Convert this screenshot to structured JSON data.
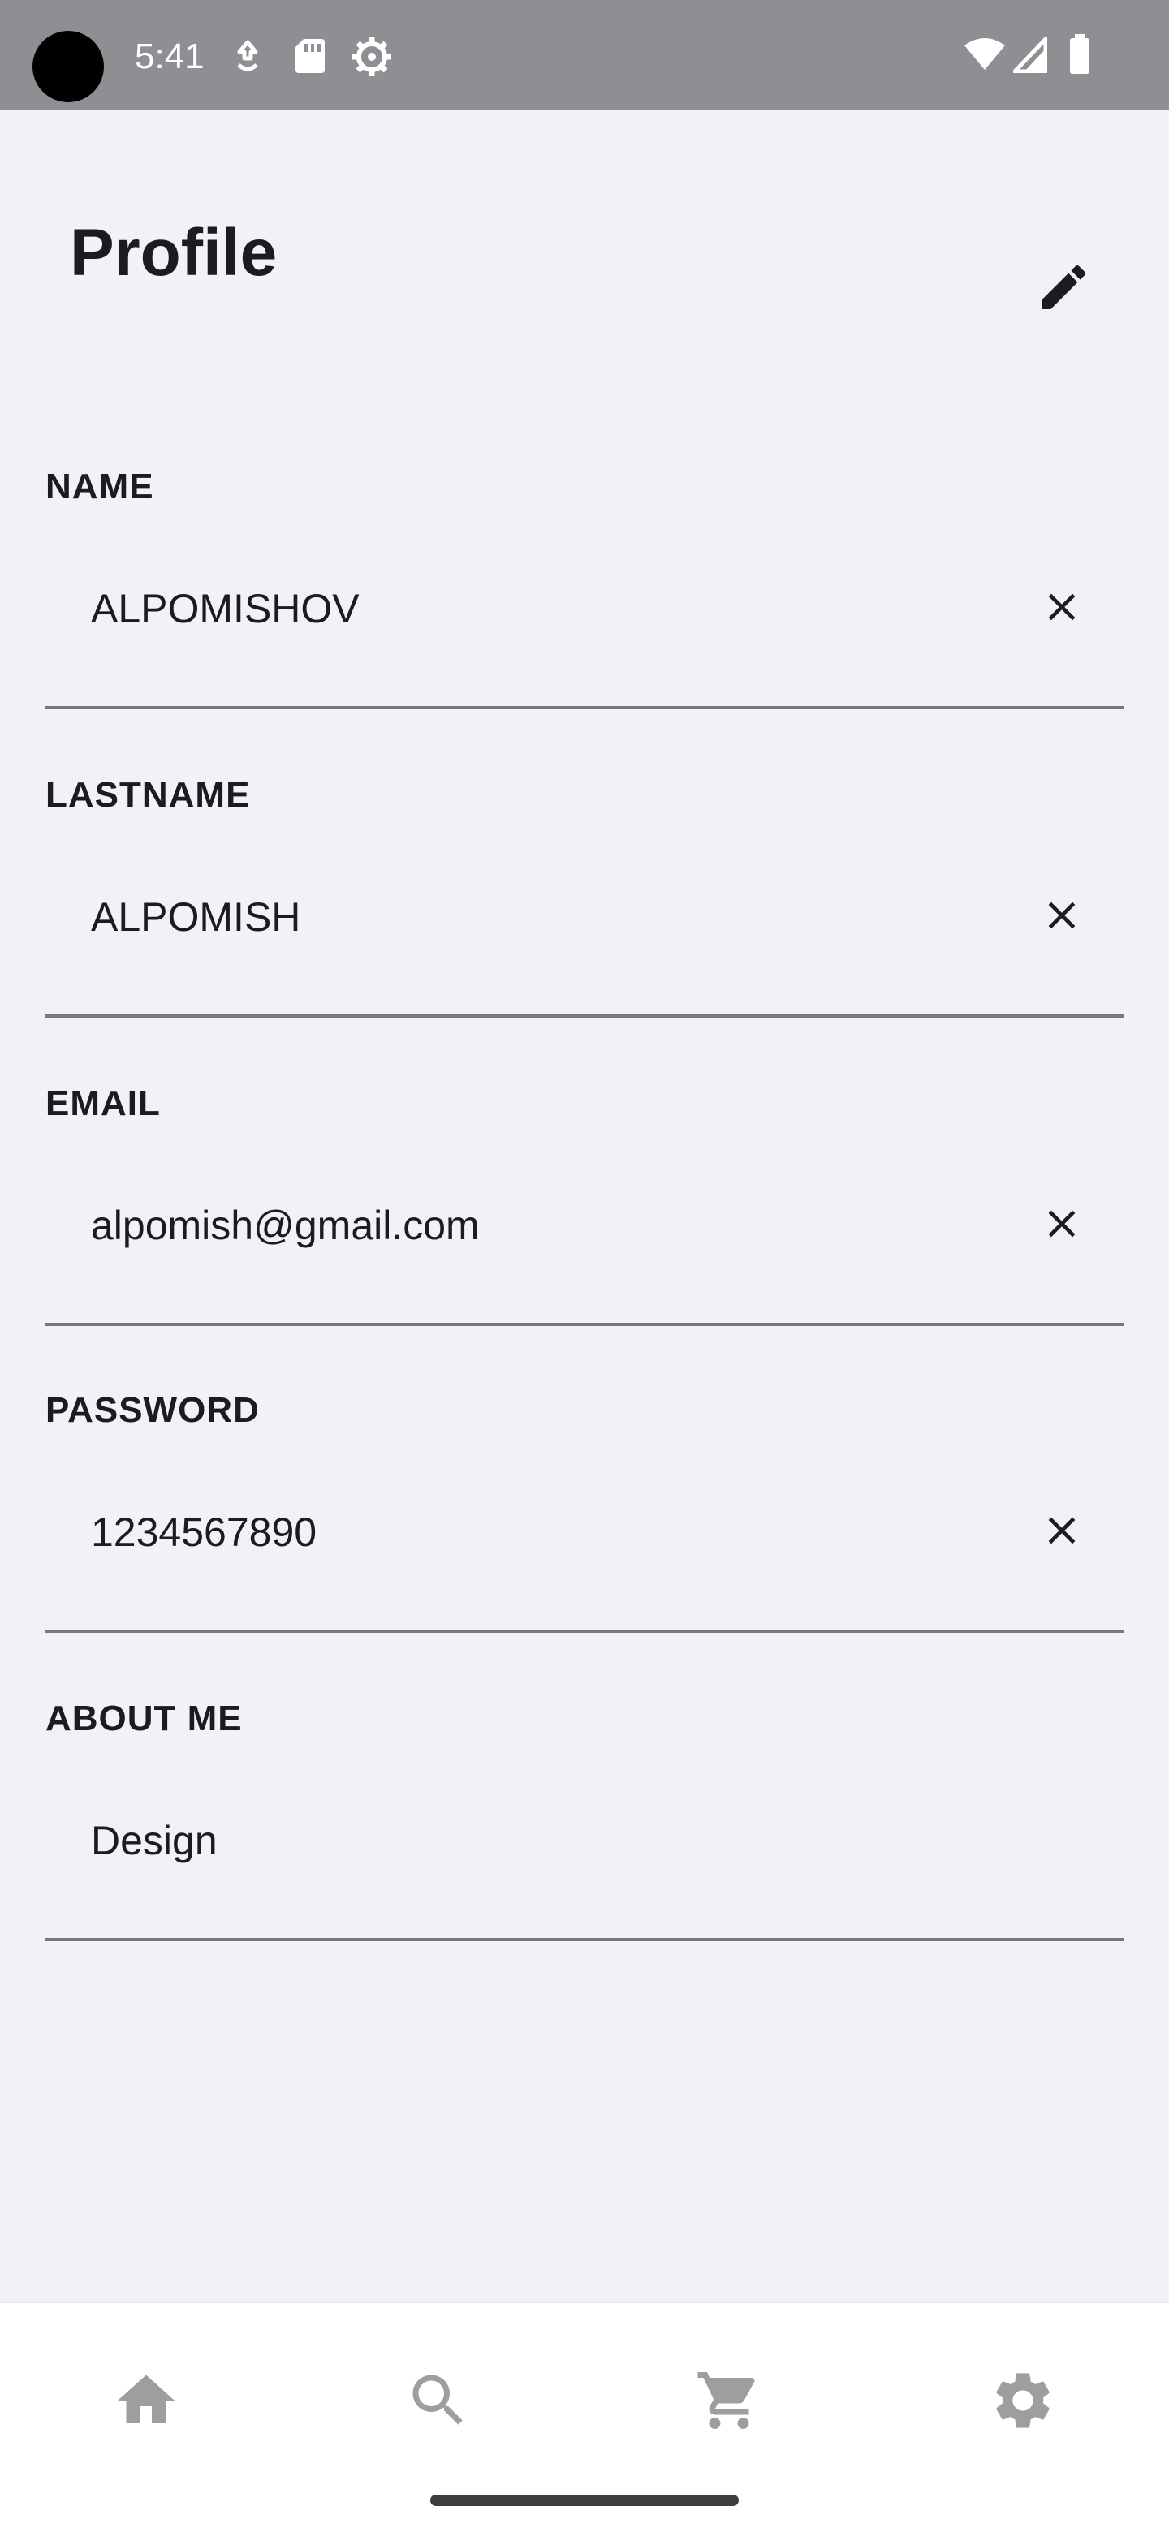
{
  "status_bar": {
    "time": "5:41",
    "icons": [
      "camera-cutout",
      "data-saver-icon",
      "sd-card-icon",
      "settings-gear-icon",
      "wifi-icon",
      "cellular-signal-icon",
      "battery-icon"
    ],
    "background": "#8e8e93"
  },
  "header": {
    "title": "Profile",
    "edit_icon": "pencil-icon"
  },
  "form": {
    "fields": [
      {
        "label": "NAME",
        "value": "ALPOMISHOV",
        "clearable": true
      },
      {
        "label": "LASTNAME",
        "value": "ALPOMISH",
        "clearable": true
      },
      {
        "label": "EMAIL",
        "value": "alpomish@gmail.com",
        "clearable": true
      },
      {
        "label": "PASSWORD",
        "value": "1234567890",
        "clearable": true
      },
      {
        "label": "ABOUT ME",
        "value": "Design",
        "clearable": false
      }
    ],
    "clear_icon": "close-icon"
  },
  "bottom_nav": {
    "items": [
      {
        "icon": "home-icon"
      },
      {
        "icon": "search-icon"
      },
      {
        "icon": "cart-icon"
      },
      {
        "icon": "settings-icon"
      }
    ],
    "icon_color": "#9e9e9e"
  },
  "colors": {
    "background": "#f1f2f6",
    "text": "#1c1b1f",
    "divider": "#79777d",
    "nav_background": "#ffffff"
  }
}
